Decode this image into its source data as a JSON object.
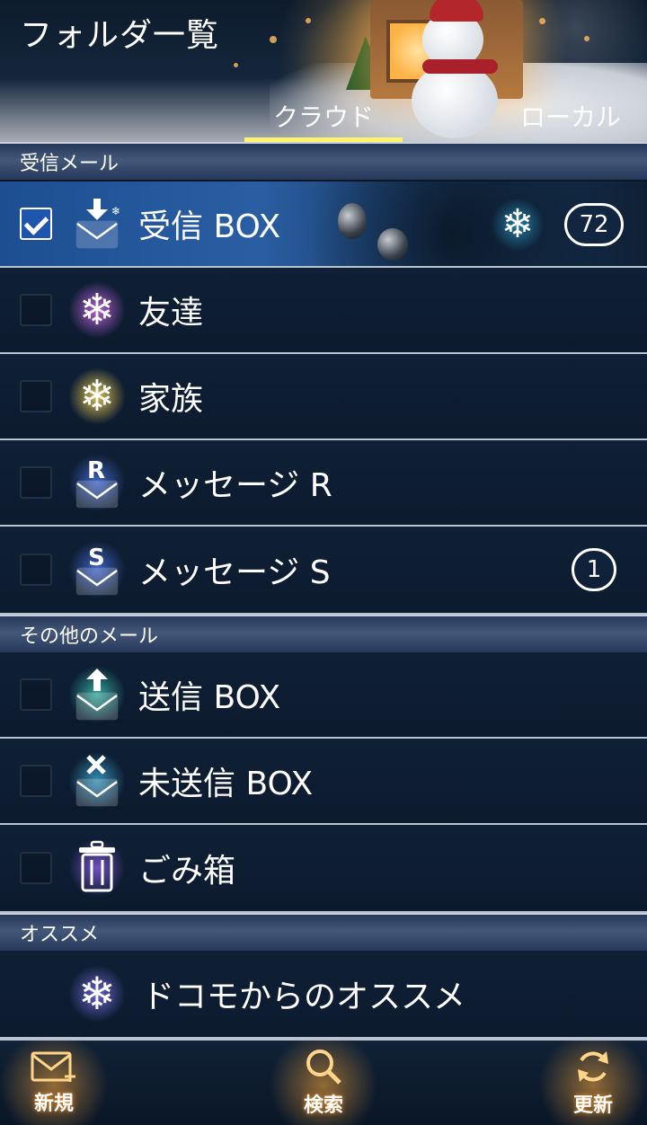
{
  "header": {
    "title": "フォルダ一覧",
    "tabs": [
      {
        "label": "クラウド",
        "active": true
      },
      {
        "label": "ローカル",
        "active": false
      }
    ]
  },
  "sections": [
    {
      "label": "受信メール",
      "folders": [
        {
          "label": "受信 BOX",
          "checked": true,
          "badge": "72",
          "icon": "inbox-download-icon"
        },
        {
          "label": "友達",
          "checked": false,
          "badge": "",
          "icon": "snowflake-icon"
        },
        {
          "label": "家族",
          "checked": false,
          "badge": "",
          "icon": "snowflake-icon"
        },
        {
          "label": "メッセージ R",
          "checked": false,
          "badge": "",
          "icon": "message-r-icon",
          "icon_letter": "R"
        },
        {
          "label": "メッセージ S",
          "checked": false,
          "badge": "1",
          "icon": "message-s-icon",
          "icon_letter": "S"
        }
      ]
    },
    {
      "label": "その他のメール",
      "folders": [
        {
          "label": "送信 BOX",
          "checked": false,
          "badge": "",
          "icon": "outbox-upload-icon"
        },
        {
          "label": "未送信 BOX",
          "checked": false,
          "badge": "",
          "icon": "unsent-mail-icon"
        },
        {
          "label": "ごみ箱",
          "checked": false,
          "badge": "",
          "icon": "trash-icon"
        }
      ]
    },
    {
      "label": "オススメ",
      "folders": [
        {
          "label": "ドコモからのオススメ",
          "icon": "snowflake-icon"
        }
      ]
    }
  ],
  "footer": {
    "new_label": "新規",
    "search_label": "検索",
    "refresh_label": "更新"
  },
  "colors": {
    "tab_underline": "#fff36e",
    "checkbox_checked": "#1f56ad",
    "background": "#0b1626"
  }
}
